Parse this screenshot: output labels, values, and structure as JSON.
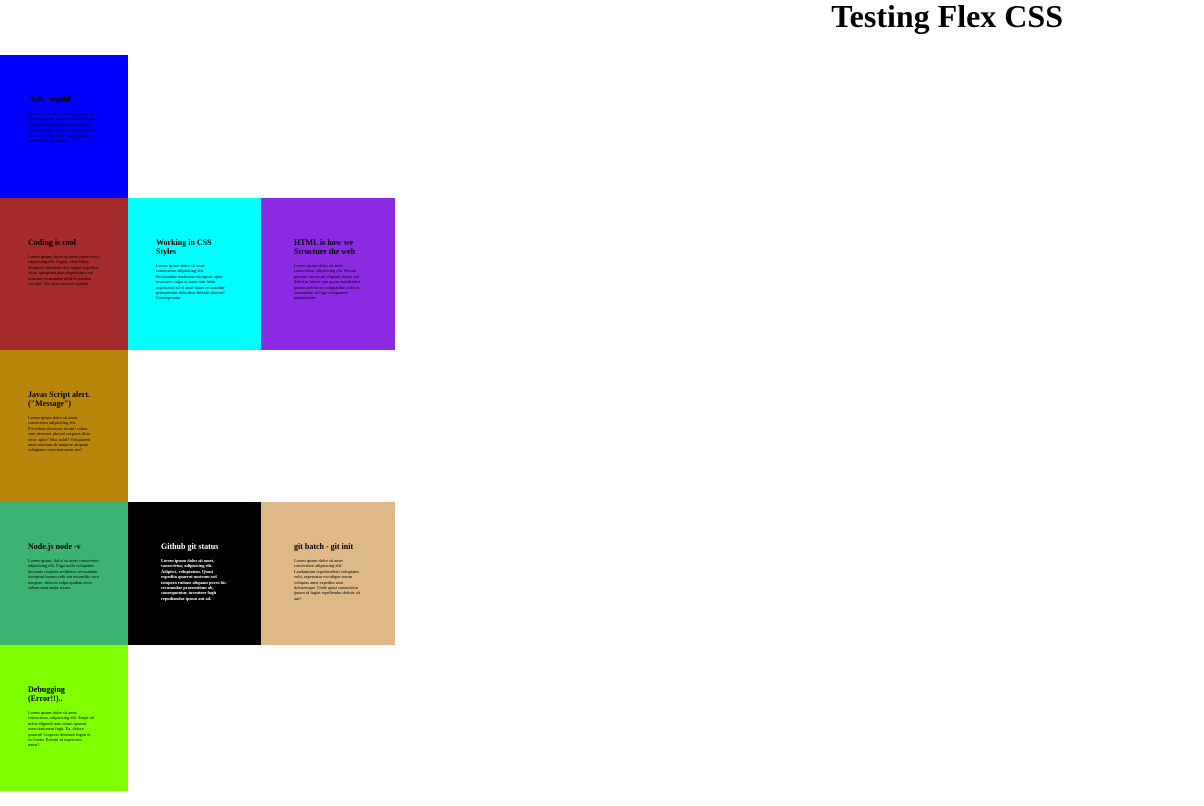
{
  "page": {
    "title": "Testing Flex CSS"
  },
  "cards": [
    {
      "heading": "Hello World!",
      "body": "Lorem ipsum dolor sit amet consectetur adipisicing elit. Nemo voluptas harum dolorem ut magni dolorum nesciunt, accusamus aut corrupti iusto fuga cum tenetur veniam dolore modi aliquid laudantium perferendis!",
      "color": "#0000ff"
    },
    {
      "heading": "Coding is cool",
      "body": "Lorem ipsum, dolor sit amet consectetur, adipisicing elit. Fugiat, vitae libero obcaecati blanditiis nisi magni expedita, vitae, quisquam alias dignissimos aut nostrum recusandae nihil id pariatur suscipit. Nos fuere moved repellat.",
      "color": "#a52a2a"
    },
    {
      "heading": "Working in CSS Styles",
      "body": "Lorem ipsum dolor sit amet consectetur adipisicing elit. Recusandae molestiae excepturi optio inventore culpa ut natus sint iusto aspernatur ad id amet natus recusandae praesentium doloribus deleniti placeat? Consequuntur.",
      "color": "#00ffff"
    },
    {
      "heading": "HTML is how we Structure the web",
      "body": "Lorem ipsum dolor sit amet consectetur, adipisicing elit. Rerum pariatur obcaecati eligendi fugiat sed delectus labore quo quam repellendus ipsum architecto voluptatibus officiis recusandae ut fuga voluptatem praesentium.",
      "color": "#8a2be2"
    },
    {
      "heading": "Javas Script alert. (\"Message\")",
      "body": "Lorem ipsum dolor sit amet, consectetur adipisicing elit. Provident obcaecati rerum! soluta cum deserunt placeat corporis dicta error optio? Nisi, nihil? Voluptatem amet nesciunt ab tempore aliquam voluptates exercitationem sint!",
      "color": "#b8860b"
    },
    {
      "heading": "Node.js node -v",
      "body": "Lorem ipsum, dolor sit amet consectetur adipisicing elit. Fuga nulla voluptates ducimus corporis architecto recusandae excepturi harum velit aut excentilis vero tempore, dolores culpa quidem error saltem sunt saepe totam.",
      "color": "#3cb371"
    },
    {
      "heading": "Github git status",
      "body": "Lorem ipsum dolor sit amet, consectetur, adipisicing elit. Adipisci, voluptatem. Quasi expedita quaerat nostrum sed tempora ratione aliquam porro hic recusandae praesentium ab, consequuntur, inventore fugit repudiandae ipsum aut ad.",
      "color": "#000000"
    },
    {
      "heading": "git batch - git init",
      "body": "Lorem ipsum dolor sit amet consectetur adipisicing elit. Laudantium reprehenderit voluptates velit, aspernatur excidique rerum voluptas amet expedita sunt doloremque. Unde quasi consectetur ipsum id fugiat repellendus debitis sit aut!",
      "color": "#deb887"
    },
    {
      "heading": "Debugging (Error!!)..",
      "body": "Lorem ipsum dolor sit amet consectetur, adipisicing elit. Saepe ad nobis eligendi nam totam quaerat exercitationem fugit. Ea, dolore quaerat! Corporis deserunt fugiat et ex lorem. Eventit id asperiores natus?",
      "color": "#7fff00"
    }
  ]
}
